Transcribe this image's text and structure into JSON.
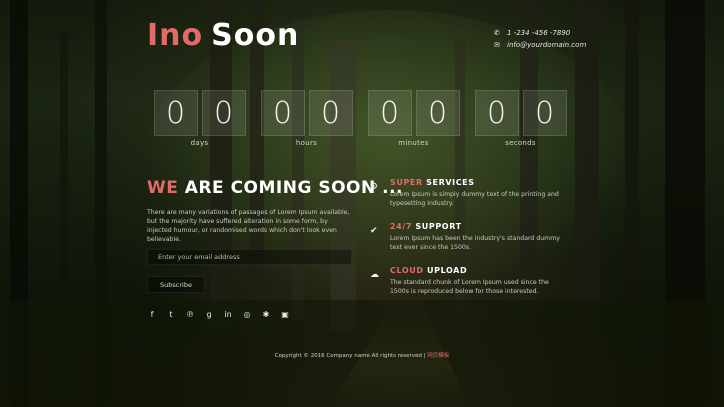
{
  "brand": {
    "part1": "Ino",
    "part2": "Soon",
    "accent": "#e26a6a"
  },
  "contact": {
    "phone": "1 -234 -456 -7890",
    "email": "info@yourdomain.com"
  },
  "countdown": [
    {
      "digits": [
        "0",
        "0"
      ],
      "label": "days"
    },
    {
      "digits": [
        "0",
        "0"
      ],
      "label": "hours"
    },
    {
      "digits": [
        "0",
        "0"
      ],
      "label": "minutes"
    },
    {
      "digits": [
        "0",
        "0"
      ],
      "label": "seconds"
    }
  ],
  "hero": {
    "highlight": "WE",
    "rest": "ARE COMING SOON ...",
    "description": "There are many variations of passages of Lorem Ipsum available, but the majority have suffered alteration in some form, by injected humour, or randomised words which don't look even believable.",
    "email_placeholder": "Enter your email address",
    "subscribe_label": "Subscribe"
  },
  "social_icons": [
    "facebook-icon",
    "twitter-icon",
    "pinterest-icon",
    "google-plus-icon",
    "linkedin-icon",
    "instagram-icon",
    "yelp-icon",
    "youtube-icon"
  ],
  "features": [
    {
      "icon": "gears-icon",
      "highlight": "SUPER",
      "rest": "SERVICES",
      "text": "Lorem Ipsum is simply dummy text of the printing and typesetting industry."
    },
    {
      "icon": "check-icon",
      "highlight": "24/7",
      "rest": "SUPPORT",
      "text": "Lorem Ipsum has been the industry's standard dummy text ever since the 1500s."
    },
    {
      "icon": "cloud-upload-icon",
      "highlight": "CLOUD",
      "rest": "UPLOAD",
      "text": "The standard chunk of Lorem Ipsum used since the 1500s is reproduced below for those interested."
    }
  ],
  "footer": {
    "text": "Copyright © 2016 Company name All rights reserved |",
    "link": "网页模板"
  }
}
